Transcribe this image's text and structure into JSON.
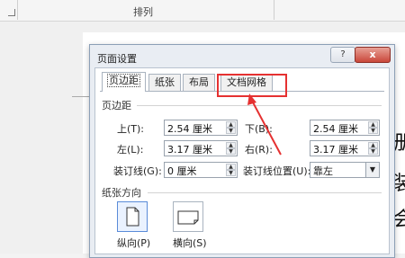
{
  "ribbon": {
    "group_label": "排列"
  },
  "dialog": {
    "title": "页面设置",
    "help_label": "?",
    "close_label": "x",
    "tabs": [
      {
        "label": "页边距"
      },
      {
        "label": "纸张"
      },
      {
        "label": "布局"
      },
      {
        "label": "文档网格"
      }
    ],
    "margins": {
      "section_label": "页边距",
      "top_label": "上(T):",
      "top_value": "2.54 厘米",
      "bottom_label": "下(B):",
      "bottom_value": "2.54 厘米",
      "left_label": "左(L):",
      "left_value": "3.17 厘米",
      "right_label": "右(R):",
      "right_value": "3.17 厘米",
      "gutter_label": "装订线(G):",
      "gutter_value": "0 厘米",
      "gutter_pos_label": "装订线位置(U):",
      "gutter_pos_value": "靠左"
    },
    "orientation": {
      "section_label": "纸张方向",
      "portrait_label": "纵向(P)",
      "landscape_label": "横向(S)"
    }
  },
  "document": {
    "chars": [
      "册",
      "装",
      "会"
    ]
  },
  "colors": {
    "highlight": "#e53131",
    "close": "#c9473a"
  }
}
